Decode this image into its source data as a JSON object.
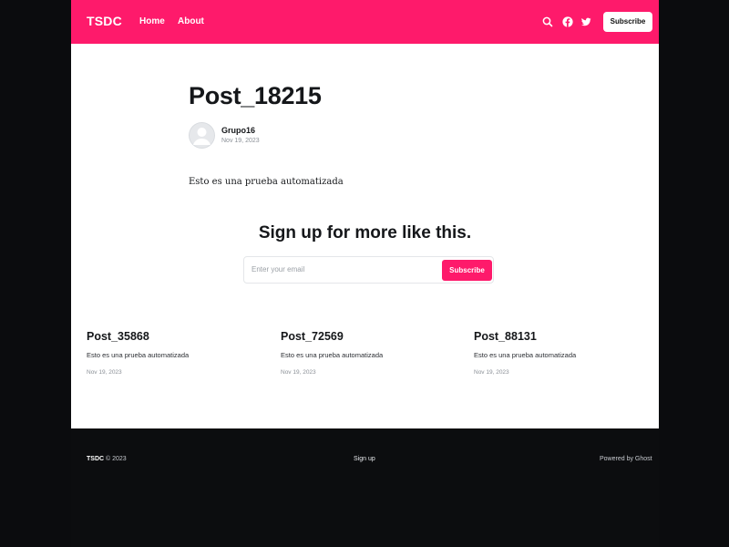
{
  "header": {
    "logo": "TSDC",
    "nav": [
      {
        "label": "Home"
      },
      {
        "label": "About"
      }
    ],
    "icons": [
      "search-icon",
      "facebook-icon",
      "twitter-icon"
    ],
    "subscribe_label": "Subscribe",
    "accent_color": "#fe1a6b"
  },
  "post": {
    "title": "Post_18215",
    "author": "Grupo16",
    "date": "Nov 19, 2023",
    "body": "Esto es una prueba automatizada"
  },
  "cta": {
    "title": "Sign up for more like this.",
    "email_placeholder": "Enter your email",
    "button_label": "Subscribe"
  },
  "related": [
    {
      "title": "Post_35868",
      "excerpt": "Esto es una prueba automatizada",
      "date": "Nov 19, 2023"
    },
    {
      "title": "Post_72569",
      "excerpt": "Esto es una prueba automatizada",
      "date": "Nov 19, 2023"
    },
    {
      "title": "Post_88131",
      "excerpt": "Esto es una prueba automatizada",
      "date": "Nov 19, 2023"
    }
  ],
  "footer": {
    "brand": "TSDC",
    "copyright": "© 2023",
    "signup_link": "Sign up",
    "powered": "Powered by Ghost"
  }
}
